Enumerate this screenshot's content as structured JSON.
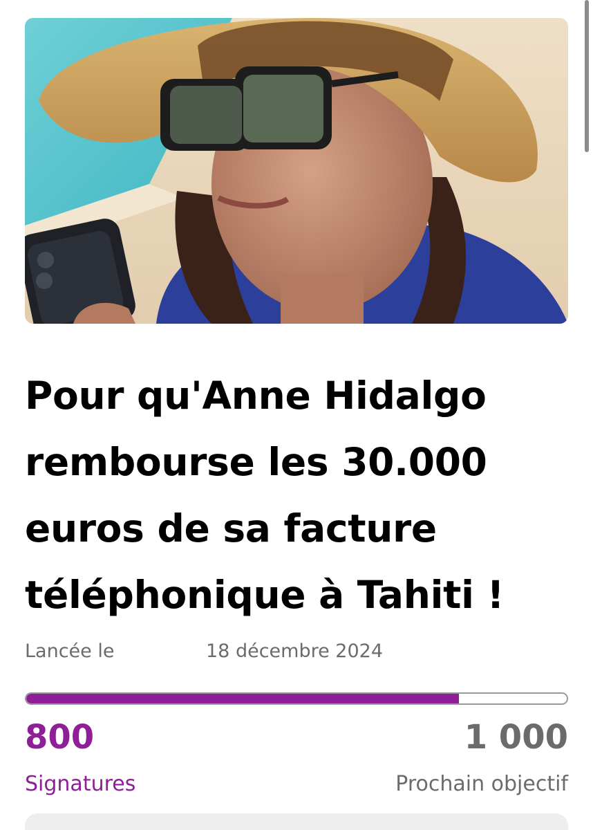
{
  "petition": {
    "title": "Pour qu'Anne Hidalgo rembourse les 30.000 euros de sa facture téléphonique à Tahiti !",
    "launch_label": "Lancée le",
    "launch_date": "18 décembre 2024",
    "progress_fraction": 0.8,
    "signatures_count": "800",
    "signatures_label": "Signatures",
    "goal_count": "1 000",
    "goal_label": "Prochain objectif"
  },
  "colors": {
    "accent": "#8e1f96",
    "muted_text": "#6b6b6b"
  }
}
